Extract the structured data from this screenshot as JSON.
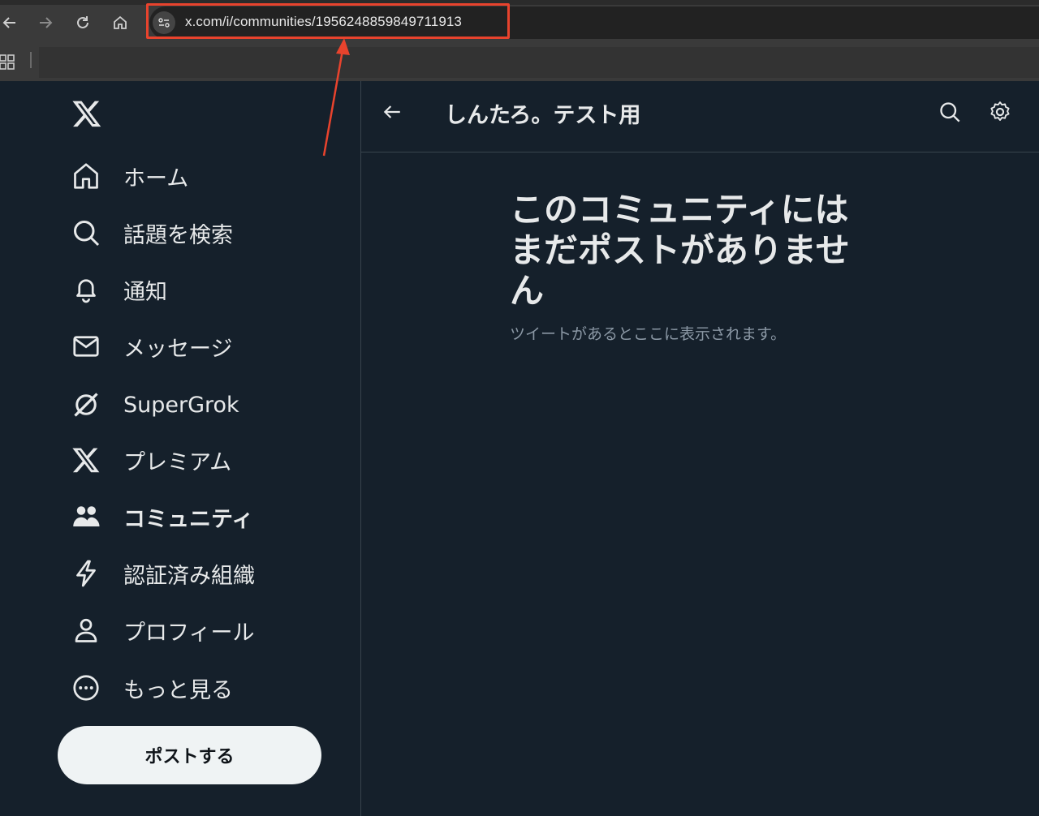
{
  "browser": {
    "url": "x.com/i/communities/1956248859849711913"
  },
  "sidebar": {
    "items": [
      {
        "label": "ホーム",
        "icon": "home-icon"
      },
      {
        "label": "話題を検索",
        "icon": "search-icon"
      },
      {
        "label": "通知",
        "icon": "bell-icon"
      },
      {
        "label": "メッセージ",
        "icon": "envelope-icon"
      },
      {
        "label": "SuperGrok",
        "icon": "grok-icon"
      },
      {
        "label": "プレミアム",
        "icon": "x-logo-icon"
      },
      {
        "label": "コミュニティ",
        "icon": "people-icon",
        "active": true
      },
      {
        "label": "認証済み組織",
        "icon": "lightning-icon"
      },
      {
        "label": "プロフィール",
        "icon": "person-icon"
      },
      {
        "label": "もっと見る",
        "icon": "more-circle-icon"
      }
    ],
    "post_button": "ポストする"
  },
  "header": {
    "title": "しんたろ。テスト用"
  },
  "empty_state": {
    "title": "このコミュニティにはまだポストがありません",
    "subtitle": "ツイートがあるとここに表示されます。"
  },
  "colors": {
    "background": "#15202b",
    "annotation": "#e8432d"
  }
}
